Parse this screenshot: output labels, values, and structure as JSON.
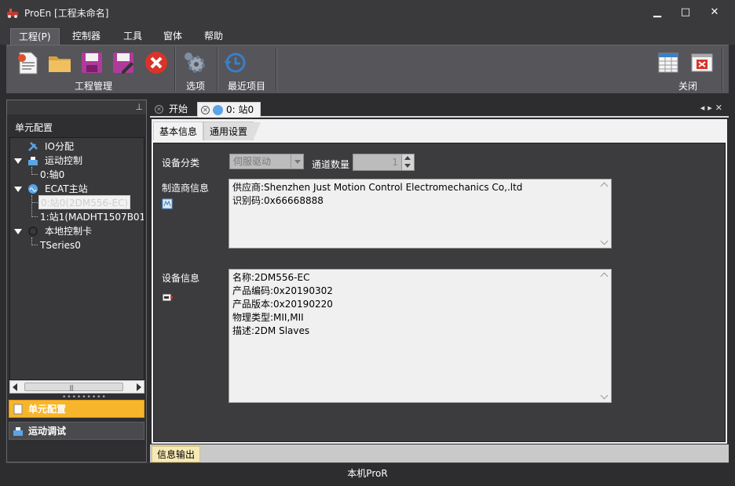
{
  "window": {
    "title": "ProEn [工程未命名]",
    "minimize": "▁",
    "maximize": "□",
    "close": "✕"
  },
  "menu": [
    "工程(P)",
    "控制器",
    "工具",
    "窗体",
    "帮助"
  ],
  "ribbon": {
    "group_project": "工程管理",
    "options": "选项",
    "recent": "最近项目",
    "close": "关闭"
  },
  "left_panel": {
    "title": "单元配置",
    "tree": {
      "io": "IO分配",
      "motion": "运动控制",
      "axis0": "0:轴0",
      "ecat": "ECAT主站",
      "station0": "0:站0(2DM556-EC)",
      "station1": "1:站1(MADHT1507B01",
      "local_card": "本地控制卡",
      "tseries": "TSeries0"
    },
    "nav_unit": "单元配置",
    "nav_motion": "运动调试"
  },
  "doc_tabs": {
    "start": "开始",
    "station": "0: 站0"
  },
  "sub_tabs": {
    "basic": "基本信息",
    "general": "通用设置"
  },
  "form": {
    "device_category_label": "设备分类",
    "device_category_value": "伺服驱动",
    "channel_count_label": "通道数量",
    "channel_count_value": "1",
    "vendor_label": "制造商信息",
    "vendor_lines": [
      "供应商:Shenzhen Just Motion Control Electromechanics Co,.ltd",
      "识别码:0x66668888"
    ],
    "device_label": "设备信息",
    "device_lines": [
      "名称:2DM556-EC",
      "产品编码:0x20190302",
      "产品版本:0x20190220",
      "物理类型:MII,MII",
      "描述:2DM Slaves"
    ]
  },
  "bottom_tab": "信息输出",
  "status": "本机ProR"
}
